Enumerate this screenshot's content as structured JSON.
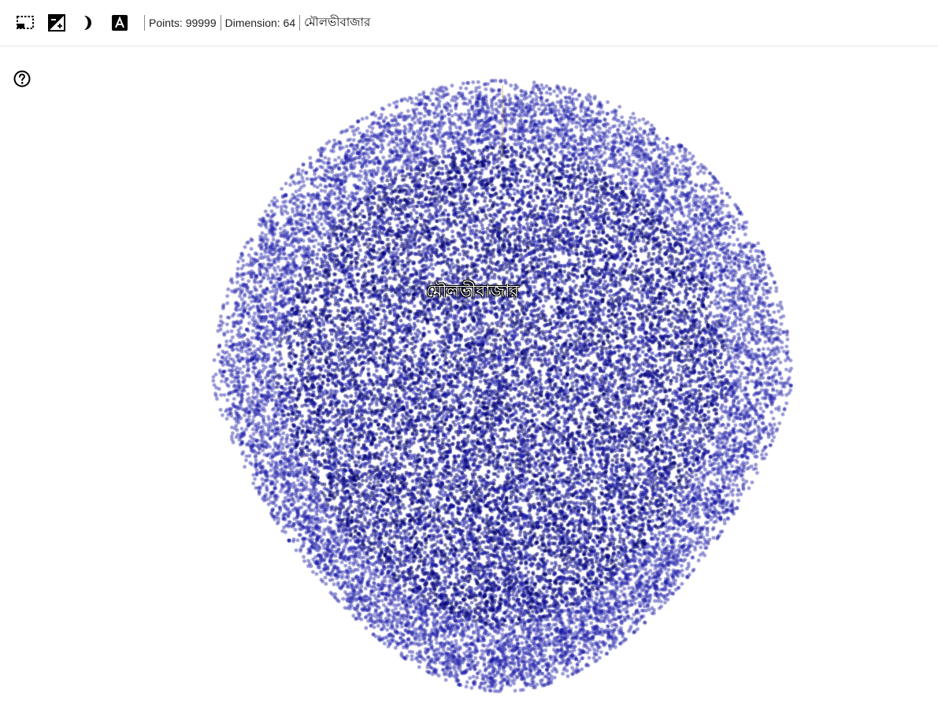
{
  "toolbar": {
    "buttons": [
      {
        "name": "selection-box-icon"
      },
      {
        "name": "night-mode-brightness-icon"
      },
      {
        "name": "half-moon-icon"
      },
      {
        "name": "label-a-icon"
      }
    ],
    "points_text": "Points: 99999",
    "dimension_text": "Dimension: 64",
    "selected_label": "মৌলভীবাজার"
  },
  "help": {
    "icon": "help-circle-icon"
  },
  "projection": {
    "label": "মৌলভীবাজার",
    "point_color": "#1a1aa6",
    "dense_color": "#00006b",
    "background": "#ffffff"
  }
}
